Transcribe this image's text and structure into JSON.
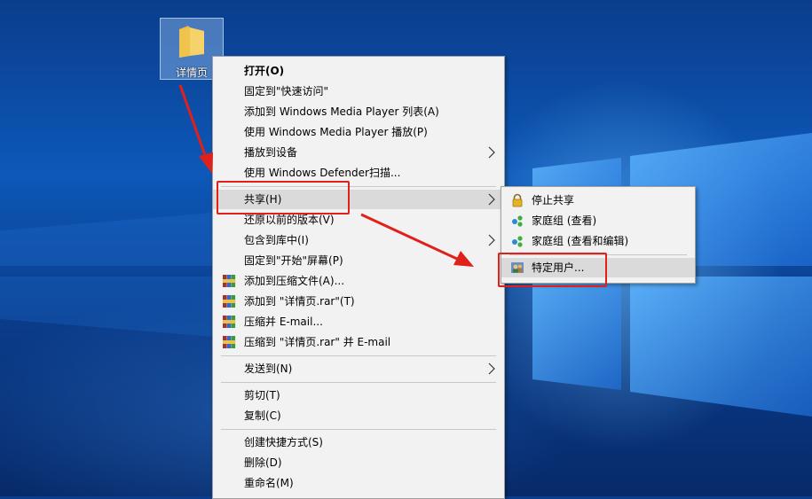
{
  "desktop": {
    "folder_label": "详情页"
  },
  "context_menu": {
    "items": [
      {
        "label": "打开(O)"
      },
      {
        "label": "固定到\"快速访问\""
      },
      {
        "label": "添加到 Windows Media Player 列表(A)"
      },
      {
        "label": "使用 Windows Media Player 播放(P)"
      },
      {
        "label": "播放到设备"
      },
      {
        "label": "使用 Windows Defender扫描..."
      },
      {
        "label": "共享(H)"
      },
      {
        "label": "还原以前的版本(V)"
      },
      {
        "label": "包含到库中(I)"
      },
      {
        "label": "固定到\"开始\"屏幕(P)"
      },
      {
        "label": "添加到压缩文件(A)..."
      },
      {
        "label": "添加到 \"详情页.rar\"(T)"
      },
      {
        "label": "压缩并 E-mail..."
      },
      {
        "label": "压缩到 \"详情页.rar\" 并 E-mail"
      },
      {
        "label": "发送到(N)"
      },
      {
        "label": "剪切(T)"
      },
      {
        "label": "复制(C)"
      },
      {
        "label": "创建快捷方式(S)"
      },
      {
        "label": "删除(D)"
      },
      {
        "label": "重命名(M)"
      }
    ]
  },
  "share_submenu": {
    "items": [
      {
        "label": "停止共享"
      },
      {
        "label": "家庭组 (查看)"
      },
      {
        "label": "家庭组 (查看和编辑)"
      },
      {
        "label": "特定用户..."
      }
    ]
  },
  "colors": {
    "annotation_red": "#e0201a",
    "menu_bg": "#f2f2f2",
    "highlight_bg": "#dadada",
    "desktop_blue": "#0d58b8"
  }
}
